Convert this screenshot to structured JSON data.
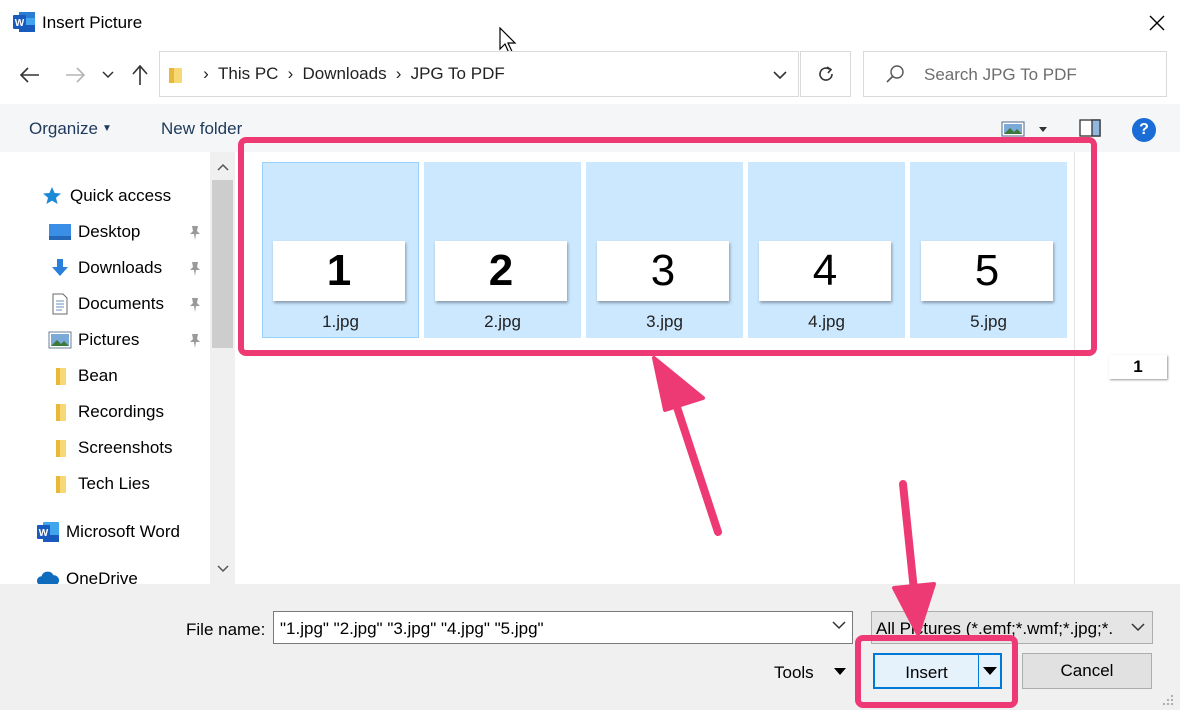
{
  "window": {
    "title": "Insert Picture"
  },
  "address": {
    "crumbs": [
      "This PC",
      "Downloads",
      "JPG To PDF"
    ]
  },
  "search": {
    "placeholder": "Search JPG To PDF"
  },
  "toolbar": {
    "organize_label": "Organize",
    "new_folder_label": "New folder"
  },
  "sidebar": {
    "items": [
      {
        "label": "Quick access",
        "icon": "star-icon",
        "pinned": false
      },
      {
        "label": "Desktop",
        "icon": "desktop-icon",
        "pinned": true
      },
      {
        "label": "Downloads",
        "icon": "download-arrow-icon",
        "pinned": true
      },
      {
        "label": "Documents",
        "icon": "document-icon",
        "pinned": true
      },
      {
        "label": "Pictures",
        "icon": "pictures-icon",
        "pinned": true
      },
      {
        "label": "Bean",
        "icon": "folder-icon",
        "pinned": false
      },
      {
        "label": "Recordings",
        "icon": "folder-icon",
        "pinned": false
      },
      {
        "label": "Screenshots",
        "icon": "folder-icon",
        "pinned": false
      },
      {
        "label": "Tech Lies",
        "icon": "folder-icon",
        "pinned": false
      },
      {
        "label": "Microsoft Word",
        "icon": "word-icon",
        "pinned": false
      },
      {
        "label": "OneDrive",
        "icon": "cloud-icon",
        "pinned": false
      }
    ]
  },
  "files": [
    {
      "name": "1.jpg",
      "thumb_text": "1",
      "selected": true
    },
    {
      "name": "2.jpg",
      "thumb_text": "2",
      "selected": true
    },
    {
      "name": "3.jpg",
      "thumb_text": "3",
      "selected": true
    },
    {
      "name": "4.jpg",
      "thumb_text": "4",
      "selected": true
    },
    {
      "name": "5.jpg",
      "thumb_text": "5",
      "selected": true
    }
  ],
  "preview": {
    "thumb_text": "1"
  },
  "footer": {
    "file_name_label": "File name:",
    "file_name_value": "\"1.jpg\" \"2.jpg\" \"3.jpg\" \"4.jpg\" \"5.jpg\"",
    "filter_value": "All Pictures (*.emf;*.wmf;*.jpg;*.",
    "tools_label": "Tools",
    "insert_label": "Insert",
    "cancel_label": "Cancel"
  },
  "colors": {
    "annotation": "#ee3a74",
    "selection": "#cce8ff",
    "accent": "#0078d7"
  }
}
